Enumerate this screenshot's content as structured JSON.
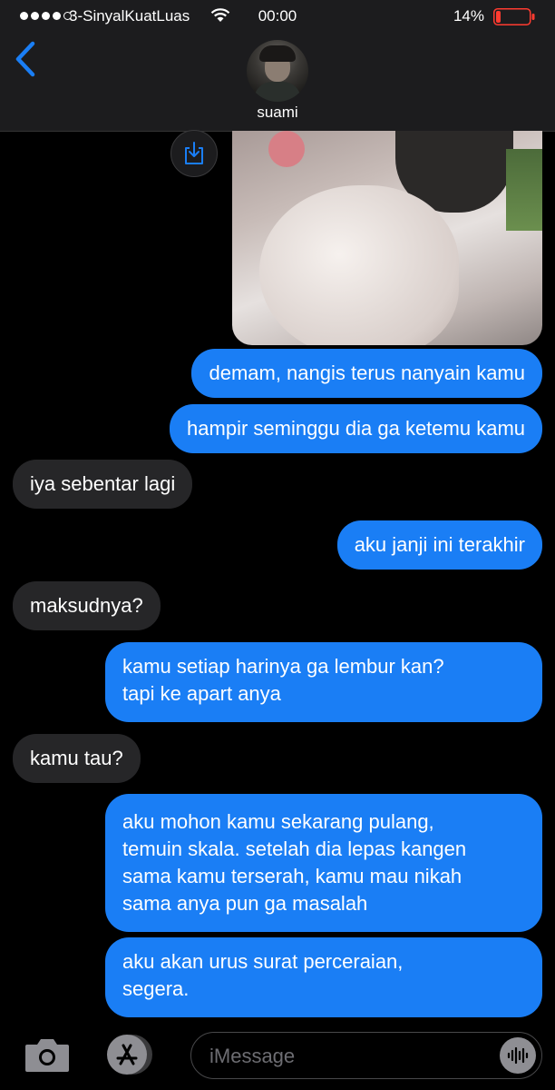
{
  "status_bar": {
    "carrier": "3-SinyalKuatLuas",
    "time": "00:00",
    "battery_percent": "14%",
    "battery_level": 0.14,
    "signal_bars_filled": 4,
    "signal_bars_total": 5
  },
  "header": {
    "contact_name": "suami"
  },
  "messages": [
    {
      "sender": "me",
      "text": "demam, nangis terus nanyain kamu"
    },
    {
      "sender": "me",
      "text": "hampir seminggu dia ga ketemu kamu"
    },
    {
      "sender": "contact",
      "text": "iya sebentar lagi"
    },
    {
      "sender": "me",
      "text": "aku janji ini terakhir"
    },
    {
      "sender": "contact",
      "text": "maksudnya?"
    },
    {
      "sender": "me",
      "lines": [
        "kamu setiap harinya ga lembur kan?",
        "tapi ke apart anya"
      ]
    },
    {
      "sender": "contact",
      "text": "kamu tau?"
    },
    {
      "sender": "me",
      "lines": [
        "aku mohon kamu sekarang pulang,",
        "temuin skala. setelah dia lepas kangen",
        "sama kamu terserah, kamu mau nikah",
        "sama anya pun ga masalah"
      ]
    },
    {
      "sender": "me",
      "lines": [
        "aku akan urus surat perceraian,",
        "segera."
      ]
    }
  ],
  "input_bar": {
    "placeholder": "iMessage"
  },
  "colors": {
    "sent_bubble": "#1a7ef5",
    "received_bubble": "#262628",
    "accent": "#1a7ef5",
    "battery_low": "#ff3b30"
  },
  "icons": [
    "back-chevron-icon",
    "save-download-icon",
    "camera-icon",
    "app-store-icon",
    "audio-waveform-icon",
    "wifi-icon",
    "battery-icon"
  ]
}
